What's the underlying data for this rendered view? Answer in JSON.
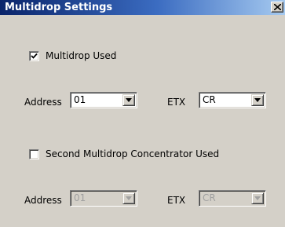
{
  "window": {
    "title": "Multidrop Settings",
    "close_glyph": "✕"
  },
  "multidrop": {
    "checkbox_label": "Multidrop Used",
    "checked": true,
    "address_label": "Address",
    "address_value": "01",
    "etx_label": "ETX",
    "etx_value": "CR"
  },
  "second_multidrop": {
    "checkbox_label": "Second Multidrop Concentrator Used",
    "checked": false,
    "address_label": "Address",
    "address_value": "01",
    "etx_label": "ETX",
    "etx_value": "CR",
    "disabled": true
  },
  "icons": {
    "close": "close-icon",
    "check": "checkmark-icon",
    "dropdown": "chevron-down-icon"
  },
  "colors": {
    "titlebar_start": "#0a246a",
    "titlebar_end": "#a6caf0",
    "dialog_bg": "#d4d0c8",
    "disabled_text": "#a0a0a0"
  }
}
